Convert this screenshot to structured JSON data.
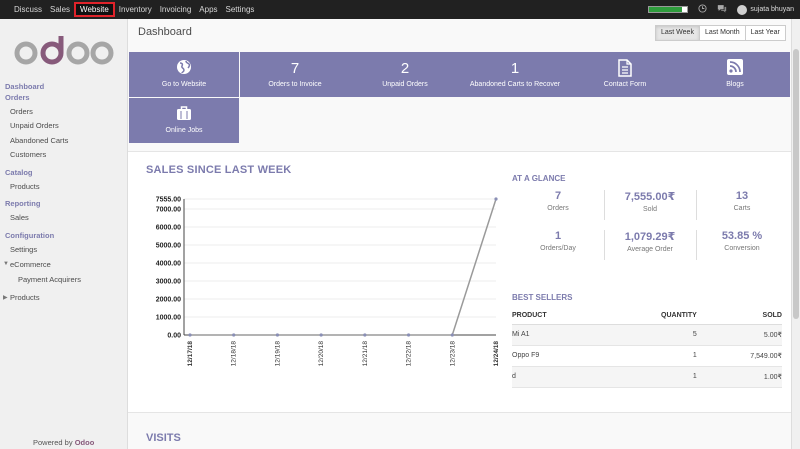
{
  "topnav": [
    "Discuss",
    "Sales",
    "Website",
    "Inventory",
    "Invoicing",
    "Apps",
    "Settings"
  ],
  "topbar": {
    "user": "sujata bhuyan",
    "progress": 0.85
  },
  "sidebar": {
    "sections": [
      {
        "head": "Dashboard",
        "items": []
      },
      {
        "head": "Orders",
        "items": [
          "Orders",
          "Unpaid Orders",
          "Abandoned Carts",
          "Customers"
        ]
      },
      {
        "head": "Catalog",
        "items": [
          "Products"
        ]
      },
      {
        "head": "Reporting",
        "items": [
          "Sales"
        ]
      },
      {
        "head": "Configuration",
        "items": [
          "Settings",
          "eCommerce",
          "Payment Acquirers",
          "Products"
        ]
      }
    ],
    "powered_prefix": "Powered by",
    "powered_brand": "Odoo"
  },
  "header": {
    "title": "Dashboard",
    "periods": [
      "Last Week",
      "Last Month",
      "Last Year"
    ]
  },
  "tiles": [
    {
      "big": "",
      "label": "Go to Website",
      "icon": "globe-icon"
    },
    {
      "big": "7",
      "label": "Orders to Invoice"
    },
    {
      "big": "2",
      "label": "Unpaid Orders"
    },
    {
      "big": "1",
      "label": "Abandoned Carts to Recover"
    },
    {
      "big": "",
      "label": "Contact Form",
      "icon": "document-icon"
    },
    {
      "big": "",
      "label": "Blogs",
      "icon": "rss-icon"
    },
    {
      "big": "",
      "label": "Online Jobs",
      "icon": "briefcase-icon"
    }
  ],
  "sales": {
    "title": "SALES SINCE LAST WEEK"
  },
  "chart_data": {
    "type": "line",
    "categories": [
      "12/17/18",
      "12/18/18",
      "12/19/18",
      "12/20/18",
      "12/21/18",
      "12/22/18",
      "12/23/18",
      "12/24/18"
    ],
    "values": [
      0,
      0,
      0,
      0,
      0,
      0,
      0,
      7555
    ],
    "yticks": [
      "0.00",
      "1000.00",
      "2000.00",
      "3000.00",
      "4000.00",
      "5000.00",
      "6000.00",
      "7000.00",
      "7555.00"
    ],
    "ylim": [
      0,
      7555
    ],
    "grid": true,
    "color": "#9a9a9a"
  },
  "glance": {
    "title": "AT A GLANCE",
    "cells": [
      {
        "value": "7",
        "label": "Orders"
      },
      {
        "value": "7,555.00₹",
        "label": "Sold"
      },
      {
        "value": "13",
        "label": "Carts"
      },
      {
        "value": "1",
        "label": "Orders/Day"
      },
      {
        "value": "1,079.29₹",
        "label": "Average Order"
      },
      {
        "value": "53.85 %",
        "label": "Conversion"
      }
    ]
  },
  "best_sellers": {
    "title": "BEST SELLERS",
    "columns": [
      "PRODUCT",
      "QUANTITY",
      "SOLD"
    ],
    "rows": [
      [
        "Mi A1",
        "5",
        "5.00₹"
      ],
      [
        "Oppo F9",
        "1",
        "7,549.00₹"
      ],
      [
        "d",
        "1",
        "1.00₹"
      ]
    ]
  },
  "visits": {
    "title": "VISITS"
  },
  "colors": {
    "accent": "#7c7bad",
    "topbar": "#212121",
    "brand": "#875a7b"
  }
}
